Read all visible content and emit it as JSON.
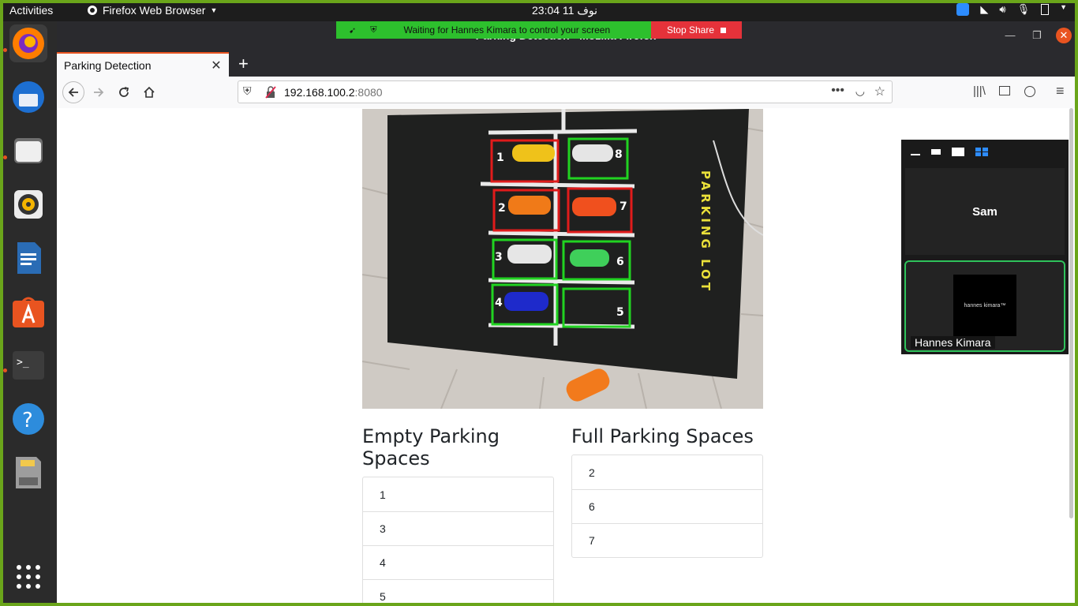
{
  "topbar": {
    "activities": "Activities",
    "app_name": "Firefox Web Browser",
    "clock": "23:04  11 نوف"
  },
  "share": {
    "message": "Waiting for Hannes Kimara to control your screen",
    "stop_label": "Stop Share"
  },
  "window": {
    "title": "Parking Detection - Mozilla Firefox"
  },
  "tab": {
    "label": "Parking Detection"
  },
  "url": {
    "host": "192.168.100.2",
    "port": ":8080"
  },
  "feed": {
    "painted_numbers": [
      "1",
      "8",
      "2",
      "7",
      "3",
      "6",
      "4",
      "5"
    ],
    "sign_text": "PARKING LOT"
  },
  "empty": {
    "title": "Empty Parking Spaces",
    "items": [
      "1",
      "3",
      "4",
      "5"
    ]
  },
  "full": {
    "title": "Full Parking Spaces",
    "items": [
      "2",
      "6",
      "7"
    ]
  },
  "zoom": {
    "speaker": "Sam",
    "participant": "Hannes Kimara",
    "thumb_text": "hannes kimara™"
  },
  "colors": {
    "occupied_box": "#e01b1b",
    "empty_box": "#21d321",
    "accent": "#e95420"
  }
}
